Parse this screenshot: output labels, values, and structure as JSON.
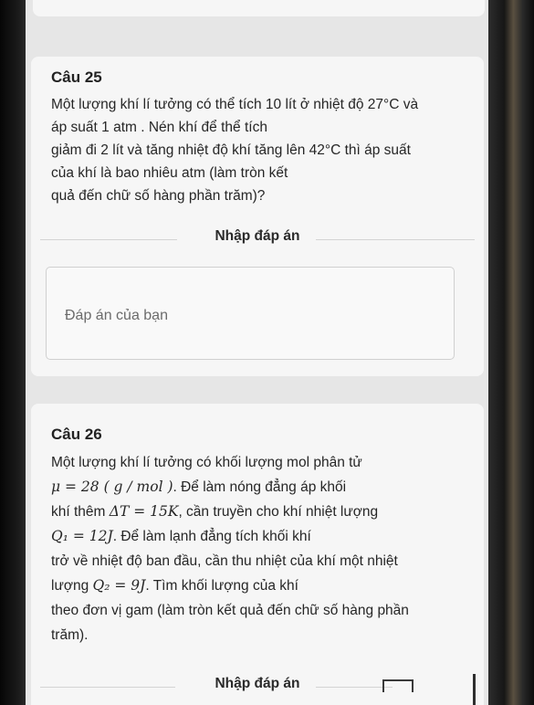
{
  "q25": {
    "title": "Câu 25",
    "lines": [
      "Một lượng khí lí tưởng có thể tích 10 lít ở nhiệt độ 27°C và",
      "áp suất 1 atm . Nén khí để thể tích",
      "giảm đi 2 lít và tăng nhiệt độ khí tăng lên 42°C thì áp suất",
      "của khí là bao nhiêu atm (làm tròn kết",
      "quả đến chữ số hàng phần trăm)?"
    ],
    "answer_heading": "Nhập đáp án",
    "answer_placeholder": "Đáp án của bạn"
  },
  "q26": {
    "title": "Câu 26",
    "line1": "Một lượng khí lí tưởng có khối lượng mol phân tử",
    "l2_math": "μ = 28 ( g / mol )",
    "l2_text": ". Để làm nóng đẳng áp khối",
    "l3_pre": "khí thêm ",
    "l3_math": "ΔT = 15K",
    "l3_post": ", cần truyền cho khí nhiệt lượng",
    "l4_math": "Q₁ = 12J",
    "l4_post": ". Để làm lạnh đẳng tích khối khí",
    "line5": "trở về nhiệt độ ban đầu, cần thu nhiệt của khí một nhiệt",
    "l6_pre": "lượng ",
    "l6_math": "Q₂ = 9J",
    "l6_post": ". Tìm khối lượng của khí",
    "line7": "theo đơn vị gam (làm tròn kết quả đến chữ số hàng phần",
    "line8": "trăm).",
    "answer_heading": "Nhập đáp án"
  }
}
